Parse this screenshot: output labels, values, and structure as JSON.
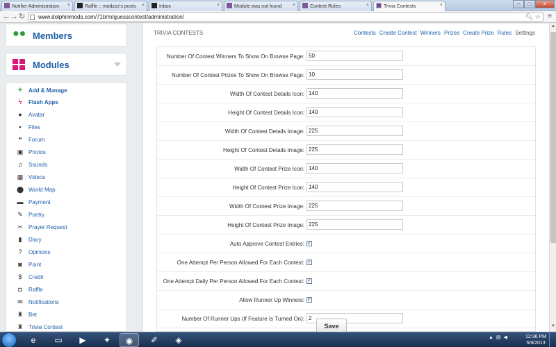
{
  "browser": {
    "tabs": [
      {
        "label": "Notifier Administration",
        "icon": "site-icon"
      },
      {
        "label": "Raffle :: modzzz's posts",
        "icon": "dm-icon"
      },
      {
        "label": "Inbox",
        "icon": "dm-icon"
      },
      {
        "label": "Module was not found",
        "icon": "site-icon"
      },
      {
        "label": "Contest Rules",
        "icon": "site-icon"
      },
      {
        "label": "Trivia Contests",
        "icon": "site-icon"
      }
    ],
    "url_host": "www.dolphinmods.com",
    "url_path": "/71b/m/guesscontest/administration/"
  },
  "sidebar": {
    "members_label": "Members",
    "modules_label": "Modules",
    "items": [
      {
        "label": "Add & Manage",
        "icon": "plus-icon",
        "glyph": "+",
        "bold": true
      },
      {
        "label": "Flash Apps",
        "icon": "flash-icon",
        "glyph": "ϟ",
        "bold": true
      },
      {
        "label": "Avatar",
        "icon": "person-icon",
        "glyph": "●"
      },
      {
        "label": "Files",
        "icon": "floppy-icon",
        "glyph": "▪"
      },
      {
        "label": "Forum",
        "icon": "chat-icon",
        "glyph": "❝"
      },
      {
        "label": "Photos",
        "icon": "picture-icon",
        "glyph": "▣"
      },
      {
        "label": "Sounds",
        "icon": "music-icon",
        "glyph": "♫"
      },
      {
        "label": "Videos",
        "icon": "film-icon",
        "glyph": "▦"
      },
      {
        "label": "World Map",
        "icon": "map-pin-icon",
        "glyph": "⬤"
      },
      {
        "label": "Payment",
        "icon": "card-icon",
        "glyph": "▬"
      },
      {
        "label": "Poetry",
        "icon": "pencil-icon",
        "glyph": "✎"
      },
      {
        "label": "Prayer Request",
        "icon": "paperclip-icon",
        "glyph": "✂"
      },
      {
        "label": "Diary",
        "icon": "book-icon",
        "glyph": "▮"
      },
      {
        "label": "Opinions",
        "icon": "question-icon",
        "glyph": "?"
      },
      {
        "label": "Point",
        "icon": "coin-icon",
        "glyph": "◙"
      },
      {
        "label": "Credit",
        "icon": "credit-icon",
        "glyph": "$"
      },
      {
        "label": "Raffle",
        "icon": "ticket-icon",
        "glyph": "◘"
      },
      {
        "label": "Notifications",
        "icon": "envelope-icon",
        "glyph": "✉"
      },
      {
        "label": "Bet",
        "icon": "trophy-icon",
        "glyph": "♜"
      },
      {
        "label": "Trivia Contest",
        "icon": "trophy-icon",
        "glyph": "♜"
      }
    ]
  },
  "main": {
    "title": "TRIVIA CONTESTS",
    "nav": [
      "Contests",
      "Create Contest",
      "Winners",
      "Prizes",
      "Create Prize",
      "Rules",
      "Settings"
    ],
    "settings": [
      {
        "label": "Number Of Contest Winners To Show On Browse Page:",
        "type": "text",
        "value": "50"
      },
      {
        "label": "Number Of Contest Prizes To Show On Browse Page:",
        "type": "text",
        "value": "10"
      },
      {
        "label": "Width Of Contest Details Icon:",
        "type": "text",
        "value": "140"
      },
      {
        "label": "Height Of Contest Details Icon:",
        "type": "text",
        "value": "140"
      },
      {
        "label": "Width Of Contest Details Image:",
        "type": "text",
        "value": "225"
      },
      {
        "label": "Height Of Contest Details Image:",
        "type": "text",
        "value": "225"
      },
      {
        "label": "Width Of Contest Prize Icon:",
        "type": "text",
        "value": "140"
      },
      {
        "label": "Height Of Contest Prize Icon:",
        "type": "text",
        "value": "140"
      },
      {
        "label": "Width Of Contest Prize Image:",
        "type": "text",
        "value": "225"
      },
      {
        "label": "Height Of Contest Prize Image:",
        "type": "text",
        "value": "225"
      },
      {
        "label": "Auto Approve Contest Entries:",
        "type": "checkbox",
        "checked": true
      },
      {
        "label": "One Attempt Per Person Allowed For Each Contest:",
        "type": "checkbox",
        "checked": true
      },
      {
        "label": "One Attempt Daily Per Person Allowed For Each Contest:",
        "type": "checkbox",
        "checked": true
      },
      {
        "label": "Allow Runner Up Winners:",
        "type": "checkbox",
        "checked": true
      },
      {
        "label": "Number Of Runner Ups (If Feature Is Turned On):",
        "type": "text",
        "value": "2"
      }
    ],
    "save_label": "Save"
  },
  "taskbar": {
    "time": "12:36 PM",
    "date": "5/9/2013"
  },
  "colors": {
    "link": "#1e5ea8",
    "members_icon": "#2a9d3a",
    "modules_icon": "#d8197a"
  }
}
